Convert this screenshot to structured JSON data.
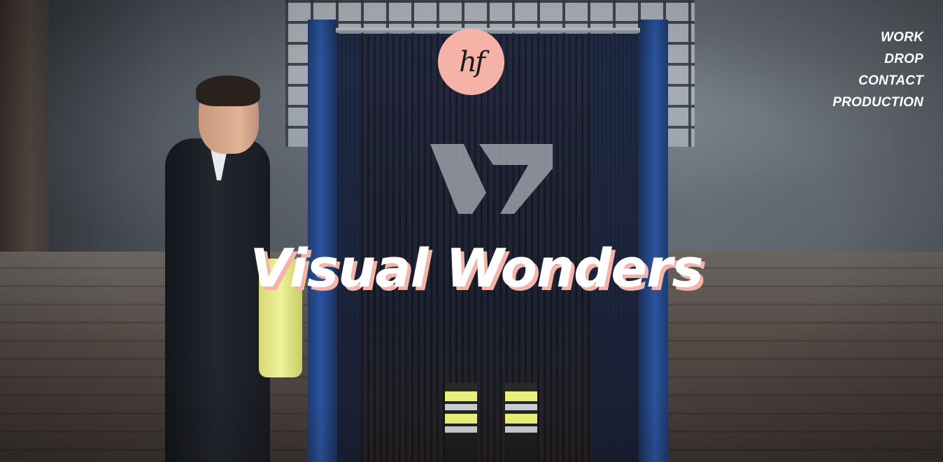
{
  "logo": {
    "text": "hf"
  },
  "nav": {
    "items": [
      {
        "label": "WORK"
      },
      {
        "label": "DROP"
      },
      {
        "label": "CONTACT"
      },
      {
        "label": "PRODUCTION"
      }
    ]
  },
  "hero": {
    "headline": "Visual Wonders"
  },
  "colors": {
    "accent": "#f5b3a8",
    "nav_text": "#ffffff",
    "headline_text": "#ffffff",
    "headline_shadow": "#f3b5aa"
  }
}
